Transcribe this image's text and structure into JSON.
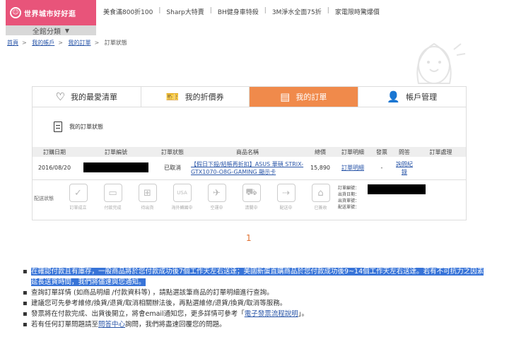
{
  "header": {
    "brand": "世界城市好好逛",
    "brand_icon": "smile-icon",
    "all_categories": "全館分類",
    "promos": [
      "美食滿800折100",
      "Sharp大特賣",
      "BH健身車特殺",
      "3M淨水全面75折",
      "家電限時驚爆價"
    ]
  },
  "breadcrumb": [
    "首頁",
    "我的帳戶",
    "我的訂單",
    "訂單狀態"
  ],
  "tabs": [
    {
      "label": "我的最愛清單",
      "icon": "heart-icon",
      "active": false
    },
    {
      "label": "我的折價券",
      "icon": "ticket-icon",
      "active": false
    },
    {
      "label": "我的訂單",
      "icon": "document-icon",
      "active": true
    },
    {
      "label": "帳戶管理",
      "icon": "user-icon",
      "active": false
    }
  ],
  "panel": {
    "title": "我的訂單狀態",
    "columns": [
      "訂購日期",
      "訂單編號",
      "訂單狀態",
      "商品名稱",
      "總價",
      "訂單明細",
      "發票",
      "問答",
      "訂單處理"
    ],
    "row": {
      "date": "2016/08/20",
      "status": "已取消",
      "product": "【假日下殺/結帳再折扣】ASUS 華碩 STRIX-GTX1070-O8G-GAMING 顯示卡",
      "total": "15,890",
      "detail": "訂單明細",
      "invoice": "-",
      "qa": "詢問紀錄",
      "process": ""
    },
    "status_label": "配送狀態",
    "steps": [
      {
        "label": "訂單成立",
        "icon": "check-doc-icon"
      },
      {
        "label": "付款完成",
        "icon": "card-icon"
      },
      {
        "label": "待出貨",
        "icon": "cart-icon"
      },
      {
        "label": "海外轉國中",
        "icon": "usa-box-icon"
      },
      {
        "label": "空運中",
        "icon": "plane-icon"
      },
      {
        "label": "清關中",
        "icon": "truck-icon"
      },
      {
        "label": "配送中",
        "icon": "delivery-icon"
      },
      {
        "label": "已簽收",
        "icon": "house-icon"
      }
    ],
    "order_info": [
      "訂單編號：",
      "出貨日期：",
      "出貨單號：",
      "配送單號："
    ]
  },
  "pager": "1",
  "notes": [
    {
      "text": "在確認付款且有庫存，一般商品將於您付款成功後7個工作天左右送達；美國新蛋直購商品於您付款成功後9~14個工作天左右送達。若有不可抗力之因素延長送貨時間，我們將儘速與您通知。",
      "highlight": true
    },
    {
      "text": "查詢訂單詳情 (如商品明細 /付款資料等) ，請點選該筆商品的訂單明細進行查詢。",
      "highlight": false
    },
    {
      "text": "建議您可先參考維修/換貨/退貨/取消相關辦法後，再點選維修/退貨/換貨/取消等服務。",
      "highlight": false
    }
  ],
  "note_invoice": {
    "before": "發票將在付款完成、出貨後開立，將會email通知您，更多詳情可參考「",
    "link": "電子發票流程說明",
    "after": "」。"
  },
  "note_qa": {
    "before": "若有任何訂單問題請至",
    "link": "問答中心",
    "after": "詢問，我們將盡速回覆您的問題。"
  }
}
